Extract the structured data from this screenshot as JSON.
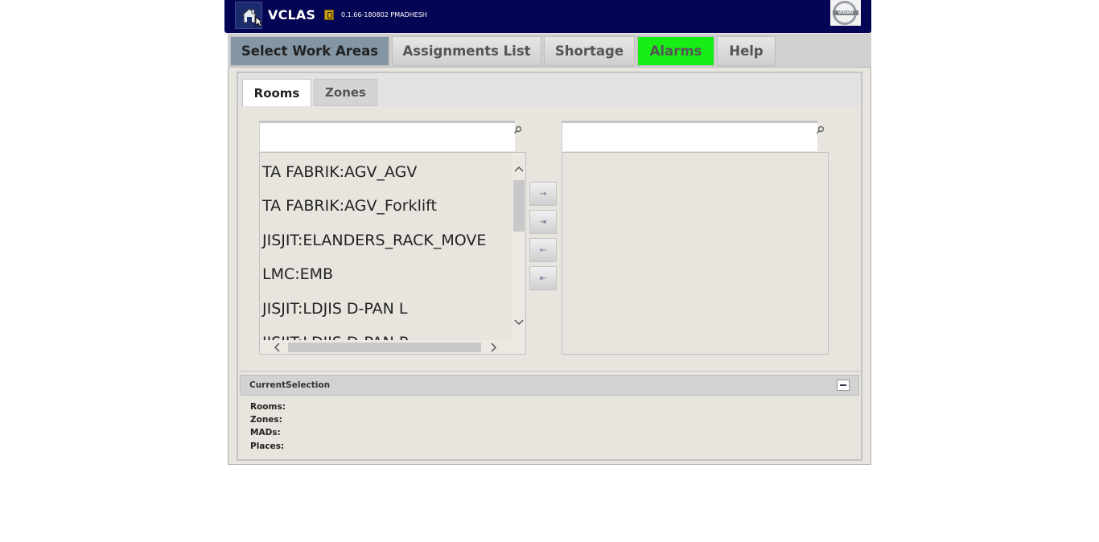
{
  "header": {
    "title": "VCLAS",
    "version": "0.1.66-180802 PMADHESH",
    "home_icon": "home-icon",
    "logo": "VOLVO"
  },
  "nav": {
    "tabs": [
      {
        "label": "Select Work Areas",
        "active": true
      },
      {
        "label": "Assignments List",
        "active": false
      },
      {
        "label": "Shortage",
        "active": false
      },
      {
        "label": "Alarms",
        "active": false,
        "color": "#16ee16"
      },
      {
        "label": "Help",
        "active": false
      }
    ]
  },
  "subtabs": [
    {
      "label": "Rooms",
      "active": true
    },
    {
      "label": "Zones",
      "active": false
    }
  ],
  "left_list": {
    "search_value": "",
    "items": [
      "TA FABRIK:AGV_AGV",
      "TA FABRIK:AGV_Forklift",
      "JISJIT:ELANDERS_RACK_MOVE",
      "LMC:EMB",
      "JISJIT:LDJIS D-PAN L",
      "JISJIT:LDJIS D-PAN R"
    ]
  },
  "right_list": {
    "search_value": "",
    "items": []
  },
  "move_buttons": [
    {
      "label": "→",
      "icon": "move-right-icon"
    },
    {
      "label": "⇥",
      "icon": "move-all-right-icon"
    },
    {
      "label": "←",
      "icon": "move-left-icon"
    },
    {
      "label": "⇤",
      "icon": "move-all-left-icon"
    }
  ],
  "current_selection": {
    "title": "CurrentSelection",
    "rows": [
      "Rooms:",
      "Zones:",
      "MADs:",
      "Places:"
    ]
  }
}
